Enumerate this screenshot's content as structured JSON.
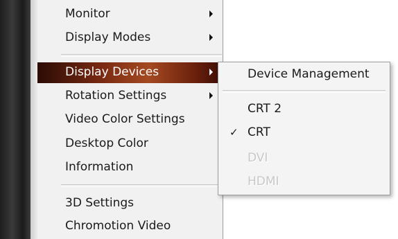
{
  "menu": {
    "items": [
      {
        "label": "Monitor",
        "has_submenu": true
      },
      {
        "label": "Display Modes",
        "has_submenu": true
      },
      {
        "label": "Display Devices",
        "has_submenu": true,
        "selected": true
      },
      {
        "label": "Rotation Settings",
        "has_submenu": true
      },
      {
        "label": "Video Color Settings",
        "has_submenu": false
      },
      {
        "label": "Desktop Color",
        "has_submenu": false
      },
      {
        "label": "Information",
        "has_submenu": false
      },
      {
        "label": "3D Settings",
        "has_submenu": false
      },
      {
        "label": "Chromotion Video",
        "has_submenu": false
      }
    ]
  },
  "submenu": {
    "items": [
      {
        "label": "Device Management",
        "enabled": true
      },
      {
        "label": "CRT 2",
        "enabled": true
      },
      {
        "label": "CRT",
        "enabled": true,
        "checked": true,
        "check_glyph": "✓"
      },
      {
        "label": "DVI",
        "enabled": false
      },
      {
        "label": "HDMI",
        "enabled": false
      }
    ]
  },
  "colors": {
    "selected_background": "#7a2a12",
    "menu_background": "#f1f1f1",
    "disabled_text": "#c8c8c8"
  }
}
